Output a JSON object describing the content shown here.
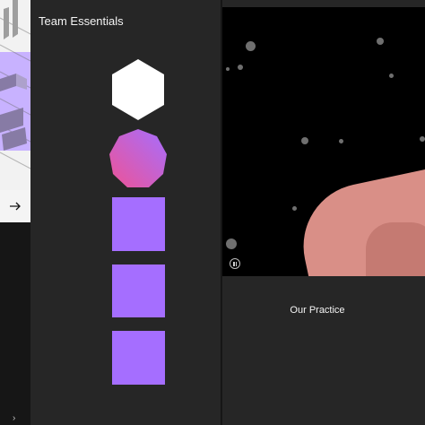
{
  "left_card": {
    "arrow_icon": "arrow-right-icon",
    "bottom_icon": "chevron-right-icon",
    "bottom_glyph": "›"
  },
  "middle_panel": {
    "title": "Team Essentials",
    "shapes": [
      {
        "name": "white-hexagon-icon",
        "color": "#ffffff"
      },
      {
        "name": "gradient-octagon-icon",
        "color_from": "#ee5396",
        "color_to": "#a56eff"
      },
      {
        "name": "purple-square-1",
        "color": "#a56eff"
      },
      {
        "name": "purple-square-2",
        "color": "#a56eff"
      },
      {
        "name": "purple-square-3",
        "color": "#a56eff"
      }
    ]
  },
  "right_panel": {
    "video_control_icon": "pause-icon",
    "caption": "Our Practice"
  },
  "colors": {
    "page_bg": "#1a1a1a",
    "panel_bg": "#262626",
    "accent_purple": "#a56eff",
    "accent_pink": "#ee5396"
  }
}
